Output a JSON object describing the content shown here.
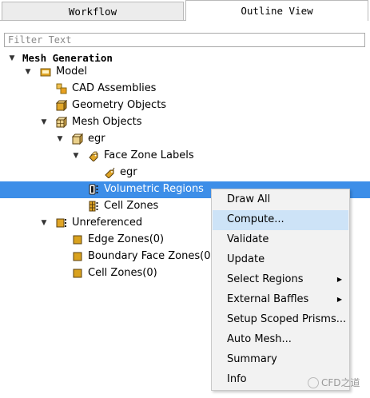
{
  "tabs": {
    "workflow": "Workflow",
    "outline_view": "Outline View"
  },
  "filter": {
    "placeholder": "Filter Text"
  },
  "tree": {
    "mesh_generation": "Mesh Generation",
    "model": "Model",
    "cad_assemblies": "CAD Assemblies",
    "geometry_objects": "Geometry Objects",
    "mesh_objects": "Mesh Objects",
    "egr": "egr",
    "face_zone_labels": "Face Zone Labels",
    "egr_child": "egr",
    "volumetric_regions": "Volumetric Regions",
    "cell_zones": "Cell Zones",
    "unreferenced": "Unreferenced",
    "edge_zones": "Edge Zones(0)",
    "boundary_face_zones": "Boundary Face Zones(0)",
    "cell_zones_0": "Cell Zones(0)"
  },
  "context_menu": {
    "draw_all": "Draw All",
    "compute": "Compute...",
    "validate": "Validate",
    "update": "Update",
    "select_regions": "Select Regions",
    "external_baffles": "External Baffles",
    "setup_scoped_prisms": "Setup Scoped Prisms...",
    "auto_mesh": "Auto Mesh...",
    "summary": "Summary",
    "info": "Info"
  },
  "watermark": {
    "text": "CFD之道"
  },
  "colors": {
    "selection": "#3d8ee8",
    "menu_hover": "#cde3f7",
    "icon_gold": "#d4a017"
  }
}
